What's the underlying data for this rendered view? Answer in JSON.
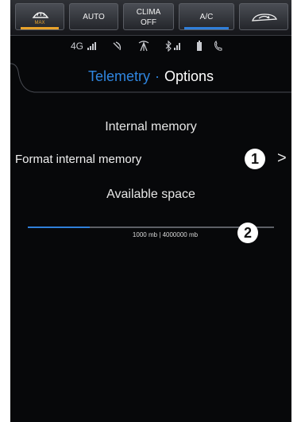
{
  "climate_bar": {
    "max_defrost": {
      "icon": "defrost-front-icon",
      "sub_label": "MAX"
    },
    "auto_label": "AUTO",
    "clima_label": "CLIMA\nOFF",
    "ac_label": "A/C",
    "recirc": {
      "icon": "air-recirculation-icon"
    },
    "colors": {
      "accent_amber": "#e8a22a",
      "accent_blue": "#2f7fd9"
    }
  },
  "status_bar": {
    "network_label": "4G",
    "icons": [
      "signal-bars-icon",
      "satellite-icon",
      "antenna-icon",
      "bluetooth-signal-icon",
      "battery-icon",
      "phone-icon"
    ]
  },
  "header": {
    "tab_telemetry": "Telemetry",
    "separator": "·",
    "tab_options": "Options"
  },
  "main": {
    "section_internal_memory": "Internal memory",
    "format_label": "Format internal memory",
    "callout_1": "1",
    "chevron": ">",
    "available_space_label": "Available space",
    "space_text": "1000 mb | 4000000 mb",
    "callout_2": "2",
    "used_fraction": 0.25,
    "colors": {
      "background": "#07080a",
      "fill": "#2f7fd9",
      "track": "#5c5f66"
    }
  }
}
